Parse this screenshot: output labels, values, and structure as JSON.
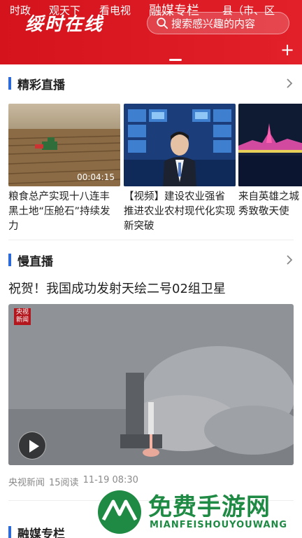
{
  "header": {
    "logo_text": "绥时在线",
    "search_placeholder": "搜索感兴趣的内容",
    "tabs": [
      {
        "label": "时政"
      },
      {
        "label": "观天下"
      },
      {
        "label": "看电视"
      },
      {
        "label": "融媒专栏",
        "active": true
      },
      {
        "label": "县（市、区"
      }
    ],
    "add_button": "+"
  },
  "live_section": {
    "title": "精彩直播",
    "cards": [
      {
        "title": "粮食总产实现十八连丰 黑土地“压舱石”持续发力",
        "duration": "00:04:15"
      },
      {
        "title": "【视频】建设农业强省 推进农业农村现代化实现新突破",
        "duration": ""
      },
      {
        "title": "来自英雄之城 武汉灯光秀致敬天使",
        "duration": ""
      }
    ]
  },
  "slow_section": {
    "title": "慢直播",
    "video_title": "祝贺！我国成功发射天绘二号02组卫星",
    "badge": "央视新闻",
    "source": "央视新闻",
    "reads": "15阅读",
    "time": "11-19 08:30"
  },
  "third_section": {
    "title": "融媒专栏"
  },
  "watermark": {
    "title": "免费手游网",
    "subtitle": "MIANFEISHOUYOUWANG"
  },
  "colors": {
    "header_red": "#e2202a",
    "section_accent": "#2d6ad9",
    "watermark_green": "#1e8a43"
  }
}
